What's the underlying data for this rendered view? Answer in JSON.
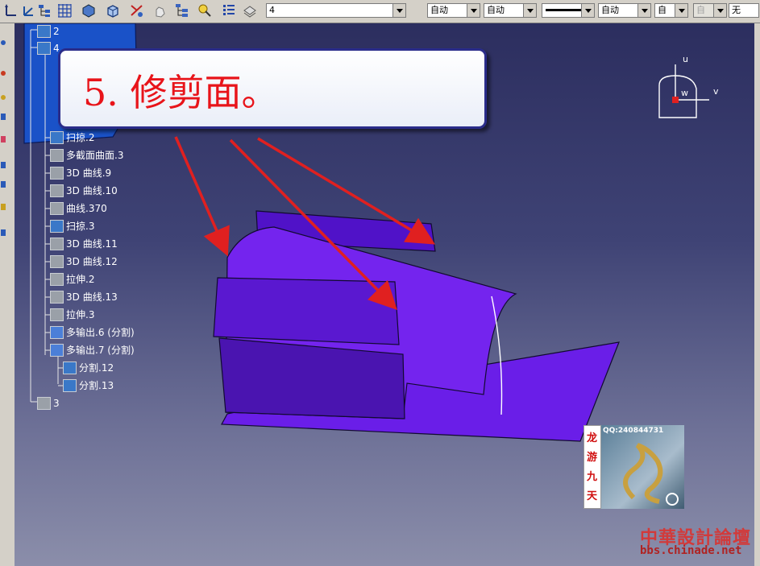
{
  "toolbar": {
    "layer_value": "4",
    "combos": [
      "自动",
      "自动",
      "自动",
      "自",
      "自",
      "无"
    ]
  },
  "callout": {
    "text": "5. 修剪面。"
  },
  "compass": {
    "u": "u",
    "v": "v",
    "w": "w"
  },
  "tree": {
    "root_items": [
      "2",
      "4",
      "3"
    ],
    "items": [
      {
        "label": "扫掠.2",
        "icon": "sweep-icon"
      },
      {
        "label": "多截面曲面.3",
        "icon": "loft-surface-icon"
      },
      {
        "label": "3D 曲线.9",
        "icon": "curve-3d-icon"
      },
      {
        "label": "3D 曲线.10",
        "icon": "curve-3d-icon"
      },
      {
        "label": "曲线.370",
        "icon": "curve-icon"
      },
      {
        "label": "扫掠.3",
        "icon": "sweep-icon"
      },
      {
        "label": "3D 曲线.11",
        "icon": "curve-3d-icon"
      },
      {
        "label": "3D 曲线.12",
        "icon": "curve-3d-icon"
      },
      {
        "label": "拉伸.2",
        "icon": "extrude-icon"
      },
      {
        "label": "3D 曲线.13",
        "icon": "curve-3d-icon"
      },
      {
        "label": "拉伸.3",
        "icon": "extrude-icon"
      },
      {
        "label": "多输出.6 (分割)",
        "icon": "multi-output-icon"
      },
      {
        "label": "多输出.7 (分割)",
        "icon": "multi-output-icon"
      },
      {
        "label": "分割.12",
        "icon": "split-icon"
      },
      {
        "label": "分割.13",
        "icon": "split-icon"
      }
    ]
  },
  "watermark": {
    "qq": "QQ:240844731",
    "title_chars": [
      "龙",
      "游",
      "九",
      "天"
    ]
  },
  "forum": {
    "name": "中華設計論壇",
    "url": "bbs.chinade.net"
  },
  "colors": {
    "surface": "#6a1ee8",
    "surface_dark": "#4a14b0",
    "arrow": "#e02020",
    "callout_text": "#e8141a"
  }
}
